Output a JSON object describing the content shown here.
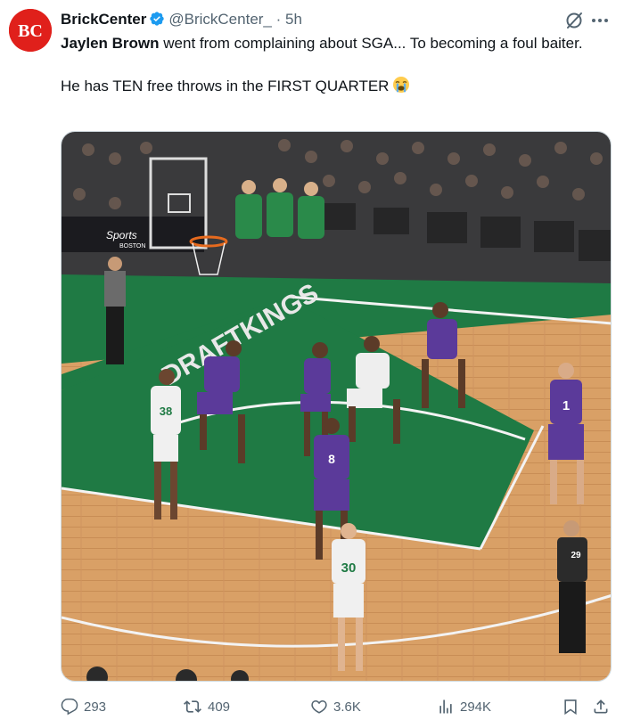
{
  "account": {
    "name": "BrickCenter",
    "handle": "@BrickCenter_",
    "separator": "·",
    "time": "5h",
    "avatar_text": "BC",
    "avatar_color": "#e0201b",
    "verified_color": "#1d9bf0"
  },
  "tweet": {
    "mention": "Jaylen Brown",
    "line1_rest": " went from complaining about SGA... To becoming a foul baiter.",
    "line2": "He has TEN free throws in the FIRST QUARTER"
  },
  "media": {
    "sponsor_text": "DRAFTKINGS",
    "broadcaster_text": "Sports",
    "broadcaster_sub": "BOSTON",
    "jersey_numbers": [
      "38",
      "8",
      "30",
      "1",
      "29"
    ],
    "colors": {
      "court": "#d9a066",
      "paint": "#1f7a44",
      "celtics_bench": "#2a8a4a",
      "suns": "#5b3a9a"
    }
  },
  "actions": {
    "replies": "293",
    "reposts": "409",
    "likes": "3.6K",
    "views": "294K"
  },
  "icons": [
    "verified-icon",
    "grok-icon",
    "more-icon",
    "reply-icon",
    "repost-icon",
    "like-icon",
    "views-icon",
    "bookmark-icon",
    "share-icon",
    "loudly-crying-face-emoji"
  ]
}
